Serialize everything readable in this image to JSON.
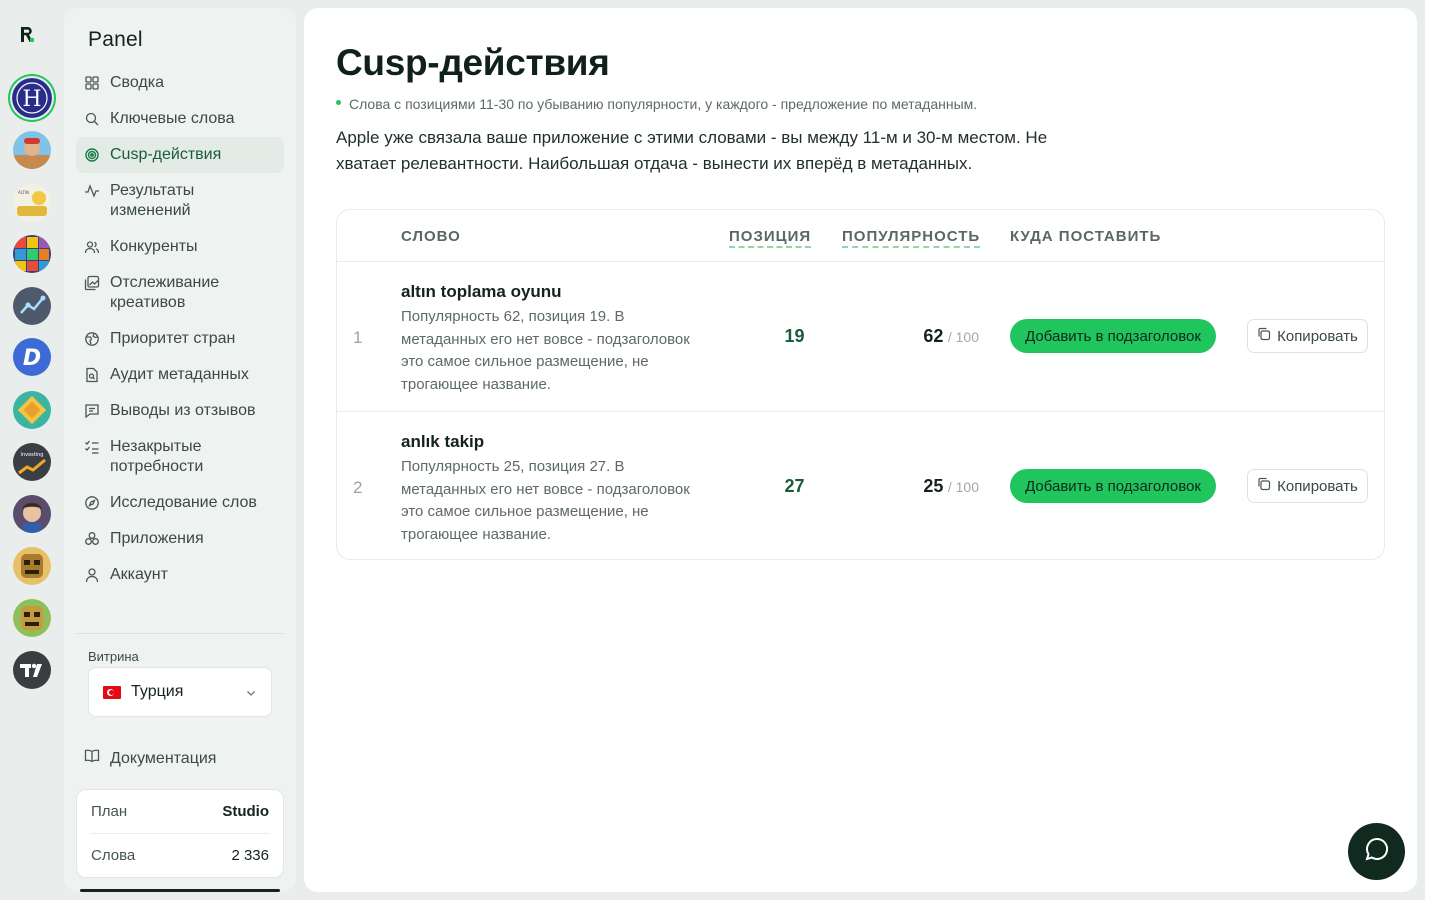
{
  "rail": {
    "apps": [
      {
        "name": "app-h",
        "active": true
      },
      {
        "name": "app-runner"
      },
      {
        "name": "app-altin"
      },
      {
        "name": "app-blocks"
      },
      {
        "name": "app-chart"
      },
      {
        "name": "app-d"
      },
      {
        "name": "app-tiles"
      },
      {
        "name": "app-investing",
        "label": "Investing"
      },
      {
        "name": "app-hero"
      },
      {
        "name": "app-mask-1"
      },
      {
        "name": "app-mask-2"
      },
      {
        "name": "app-tv"
      }
    ]
  },
  "sidebar": {
    "brand": "Panel",
    "items": [
      {
        "label": "Сводка",
        "icon": "grid-icon"
      },
      {
        "label": "Ключевые слова",
        "icon": "search-icon"
      },
      {
        "label": "Cusp-действия",
        "icon": "target-icon",
        "active": true
      },
      {
        "label": "Результаты изменений",
        "icon": "activity-icon"
      },
      {
        "label": "Конкуренты",
        "icon": "users-icon"
      },
      {
        "label": "Отслеживание креативов",
        "icon": "images-icon"
      },
      {
        "label": "Приоритет стран",
        "icon": "globe-icon"
      },
      {
        "label": "Аудит метаданных",
        "icon": "file-search-icon"
      },
      {
        "label": "Выводы из отзывов",
        "icon": "message-icon"
      },
      {
        "label": "Незакрытые потребности",
        "icon": "list-check-icon"
      },
      {
        "label": "Исследование слов",
        "icon": "compass-icon"
      },
      {
        "label": "Приложения",
        "icon": "boxes-icon"
      },
      {
        "label": "Аккаунт",
        "icon": "user-icon"
      }
    ],
    "store_label": "Витрина",
    "store_value": "Турция",
    "docs_label": "Документация",
    "plan": {
      "plan_key": "План",
      "plan_value": "Studio",
      "words_key": "Слова",
      "words_value": "2 336"
    }
  },
  "main": {
    "title": "Cusp-действия",
    "subtitle": "Слова с позициями 11-30 по убыванию популярности, у каждого - предложение по метаданным.",
    "lead": "Apple уже связала ваше приложение с этими словами - вы между 11-м и 30-м местом. Не хватает релевантности. Наибольшая отдача - вынести их вперёд в метаданных.",
    "table": {
      "headers": {
        "word": "СЛОВО",
        "position": "ПОЗИЦИЯ",
        "popularity": "ПОПУЛЯРНОСТЬ",
        "placement": "КУДА ПОСТАВИТЬ"
      },
      "rows": [
        {
          "index": "1",
          "keyword": "altın toplama oyunu",
          "description": "Популярность 62, позиция 19. В метаданных его нет вовсе - подзаголовок это самое сильное размещение, не трогающее название.",
          "position": "19",
          "popularity": "62",
          "popularity_max": "/ 100",
          "action": "Добавить в подзаголовок",
          "copy": "Копировать"
        },
        {
          "index": "2",
          "keyword": "anlık takip",
          "description": "Популярность 25, позиция 27. В метаданных его нет вовсе - подзаголовок это самое сильное размещение, не трогающее название.",
          "position": "27",
          "popularity": "25",
          "popularity_max": "/ 100",
          "action": "Добавить в подзаголовок",
          "copy": "Копировать"
        }
      ]
    }
  },
  "colors": {
    "accent": "#21c55d",
    "active_nav": "#1a5b3b",
    "chat_button": "#102a1f"
  }
}
